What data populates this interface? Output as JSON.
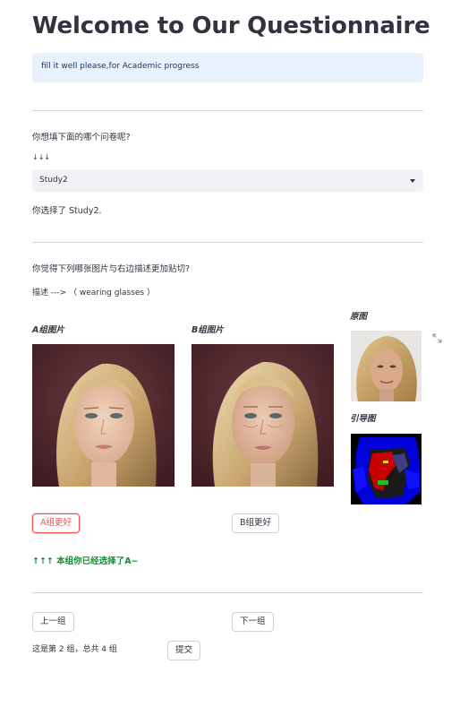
{
  "page": {
    "title": "Welcome to Our Questionnaire",
    "info_text": "fill it well please,for Academic progress"
  },
  "study_select": {
    "question": "你想填下面的哪个问卷呢?",
    "arrows": "↓↓↓",
    "selected_value": "Study2",
    "confirmation": "你选择了 Study2."
  },
  "comparison": {
    "question": "你觉得下列哪张图片与右边描述更加贴切?",
    "description": "描述 --->  （ wearing glasses ）",
    "group_a_label": "A组图片",
    "group_b_label": "B组图片",
    "original_label": "原图",
    "guide_label": "引导图",
    "button_a": "A组更好",
    "button_b": "B组更好",
    "selected": "A",
    "selection_status": "↑↑↑ 本组你已经选择了A~"
  },
  "navigation": {
    "prev_label": "上一组",
    "next_label": "下一组",
    "progress_text": "这是第 2 组，总共 4 组",
    "submit_label": "提交"
  },
  "colors": {
    "accent": "#ff4b4b",
    "success": "#138a36",
    "info_bg": "#e8f1fc"
  },
  "icons": {
    "select_caret": "caret-down-icon",
    "fullscreen": "expand-icon"
  }
}
